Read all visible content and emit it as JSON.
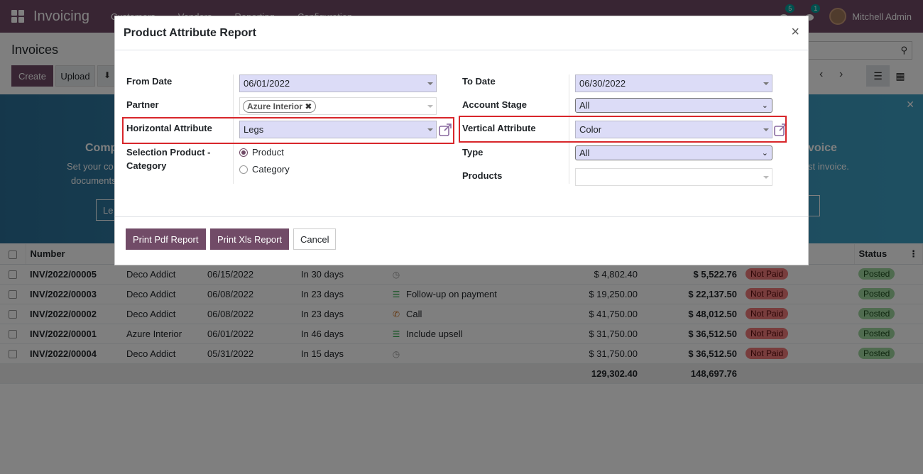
{
  "navbar": {
    "app_name": "Invoicing",
    "menu": [
      "Customers",
      "Vendors",
      "Reporting",
      "Configuration"
    ],
    "messages_count": "5",
    "activities_count": "1",
    "user_name": "Mitchell Admin"
  },
  "control_panel": {
    "title": "Invoices",
    "create_label": "Create",
    "upload_label": "Upload"
  },
  "banner": {
    "left_title": "Comp",
    "left_line1": "Set your co",
    "left_line2": "documents",
    "left_button": "Le",
    "right_title": "voice",
    "right_line1": "st invoice.",
    "right_button": "e"
  },
  "table": {
    "columns": [
      "Number",
      "Status"
    ],
    "rows": [
      {
        "number": "INV/2022/00005",
        "partner": "Deco Addict",
        "date": "06/15/2022",
        "due": "In 30 days",
        "activity": "",
        "activity_icon": "clock-icon",
        "untaxed": "$ 4,802.40",
        "total": "$ 5,522.76",
        "payment": "Not Paid",
        "status": "Posted"
      },
      {
        "number": "INV/2022/00003",
        "partner": "Deco Addict",
        "date": "06/08/2022",
        "due": "In 23 days",
        "activity": "Follow-up on payment",
        "activity_icon": "list-icon",
        "untaxed": "$ 19,250.00",
        "total": "$ 22,137.50",
        "payment": "Not Paid",
        "status": "Posted"
      },
      {
        "number": "INV/2022/00002",
        "partner": "Deco Addict",
        "date": "06/08/2022",
        "due": "In 23 days",
        "activity": "Call",
        "activity_icon": "phone-icon",
        "untaxed": "$ 41,750.00",
        "total": "$ 48,012.50",
        "payment": "Not Paid",
        "status": "Posted"
      },
      {
        "number": "INV/2022/00001",
        "partner": "Azure Interior",
        "date": "06/01/2022",
        "due": "In 46 days",
        "activity": "Include upsell",
        "activity_icon": "list-icon",
        "untaxed": "$ 31,750.00",
        "total": "$ 36,512.50",
        "payment": "Not Paid",
        "status": "Posted"
      },
      {
        "number": "INV/2022/00004",
        "partner": "Deco Addict",
        "date": "05/31/2022",
        "due": "In 15 days",
        "activity": "",
        "activity_icon": "clock-icon",
        "untaxed": "$ 31,750.00",
        "total": "$ 36,512.50",
        "payment": "Not Paid",
        "status": "Posted"
      }
    ],
    "total_untaxed": "129,302.40",
    "total_total": "148,697.76"
  },
  "modal": {
    "title": "Product Attribute Report",
    "close": "×",
    "from_date_label": "From Date",
    "from_date_value": "06/01/2022",
    "to_date_label": "To Date",
    "to_date_value": "06/30/2022",
    "partner_label": "Partner",
    "partner_tag": "Azure Interior",
    "account_stage_label": "Account Stage",
    "account_stage_value": "All",
    "horizontal_label": "Horizontal Attribute",
    "horizontal_value": "Legs",
    "vertical_label": "Vertical Attribute",
    "vertical_value": "Color",
    "selection_label_1": "Selection Product -",
    "selection_label_2": "Category",
    "option_product": "Product",
    "option_category": "Category",
    "type_label": "Type",
    "type_value": "All",
    "products_label": "Products",
    "print_pdf_label": "Print Pdf Report",
    "print_xls_label": "Print Xls Report",
    "cancel_label": "Cancel"
  },
  "colors": {
    "brand": "#714b67",
    "highlight": "#d8262b",
    "not_paid": "#f07a7a",
    "posted": "#9fd79f"
  }
}
